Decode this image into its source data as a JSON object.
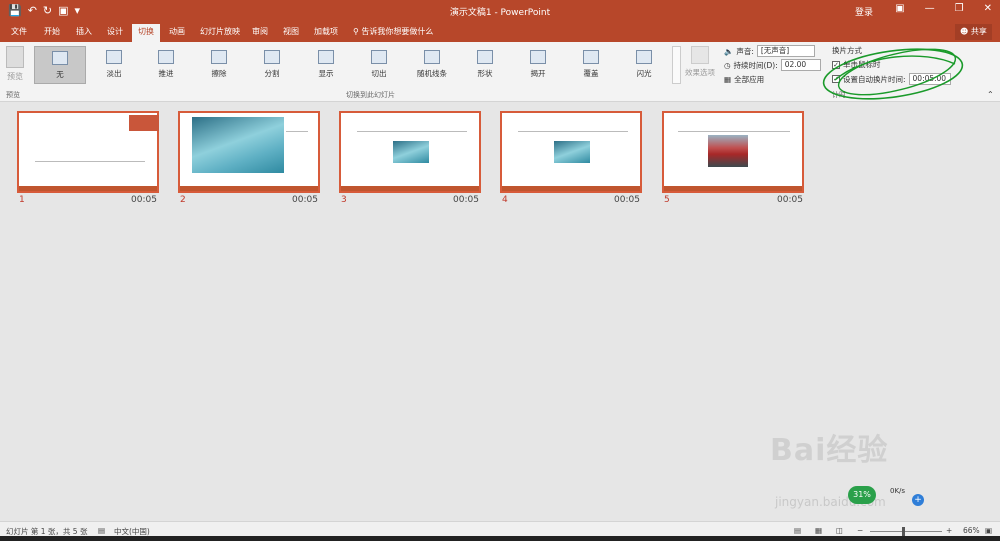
{
  "titlebar": {
    "title": "演示文稿1 - PowerPoint",
    "login": "登录"
  },
  "tabs": [
    {
      "label": "文件"
    },
    {
      "label": "开始"
    },
    {
      "label": "插入"
    },
    {
      "label": "设计"
    },
    {
      "label": "切换"
    },
    {
      "label": "动画"
    },
    {
      "label": "幻灯片放映"
    },
    {
      "label": "审阅"
    },
    {
      "label": "视图"
    },
    {
      "label": "加载项"
    }
  ],
  "tell_me": "告诉我你想要做什么",
  "share": "共享",
  "ribbon": {
    "preview": "预览",
    "preview_group": "预览",
    "transitions_group": "切换到此幻灯片",
    "transitions": [
      {
        "label": "无"
      },
      {
        "label": "淡出"
      },
      {
        "label": "推进"
      },
      {
        "label": "擦除"
      },
      {
        "label": "分割"
      },
      {
        "label": "显示"
      },
      {
        "label": "切出"
      },
      {
        "label": "随机线条"
      },
      {
        "label": "形状"
      },
      {
        "label": "揭开"
      },
      {
        "label": "覆盖"
      },
      {
        "label": "闪光"
      }
    ],
    "effect_options": "效果选项",
    "sound_label": "声音:",
    "sound_value": "[无声音]",
    "duration_label": "持续时间(D):",
    "duration_value": "02.00",
    "apply_all": "全部应用",
    "advance_title": "换片方式",
    "on_click": "单击鼠标时",
    "after_label": "设置自动换片时间:",
    "after_value": "00:05.00",
    "timing_group": "计时"
  },
  "slides": [
    {
      "number": "1",
      "duration": "00:05"
    },
    {
      "number": "2",
      "duration": "00:05"
    },
    {
      "number": "3",
      "duration": "00:05"
    },
    {
      "number": "4",
      "duration": "00:05"
    },
    {
      "number": "5",
      "duration": "00:05"
    }
  ],
  "status": {
    "slide_info": "幻灯片 第 1 张，共 5 张",
    "language": "中文(中国)",
    "zoom": "66%"
  },
  "overlay": {
    "speed": "31%",
    "net": "0K/s"
  },
  "watermark": {
    "brand": "Bai经验",
    "url": "jingyan.baidu.com"
  }
}
